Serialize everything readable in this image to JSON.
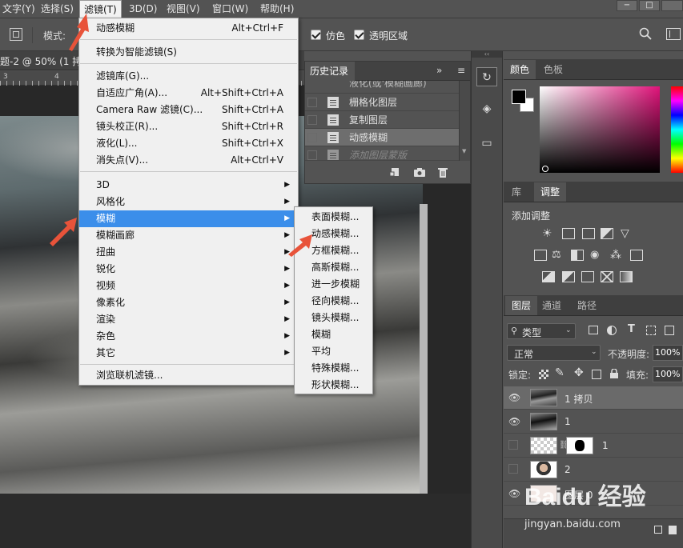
{
  "menubar": {
    "items": [
      "文字(Y)",
      "选择(S)",
      "滤镜(T)",
      "3D(D)",
      "视图(V)",
      "窗口(W)",
      "帮助(H)"
    ],
    "active": "滤镜(T)"
  },
  "window_controls": {
    "minimize": "−",
    "restore": "□"
  },
  "options": {
    "mode_label": "模式:",
    "dither_label": "仿色",
    "transparency_label": "透明区域"
  },
  "doc_tab": {
    "title": "题-2 @ 50% (1 拷"
  },
  "ruler": {
    "marks": [
      "3",
      "4"
    ]
  },
  "filter_menu": {
    "items": [
      {
        "label": "动感模糊",
        "shortcut": "Alt+Ctrl+F"
      },
      {
        "label": "转换为智能滤镜(S)",
        "shortcut": ""
      },
      {
        "label": "滤镜库(G)...",
        "shortcut": ""
      },
      {
        "label": "自适应广角(A)...",
        "shortcut": "Alt+Shift+Ctrl+A"
      },
      {
        "label": "Camera Raw 滤镜(C)...",
        "shortcut": "Shift+Ctrl+A"
      },
      {
        "label": "镜头校正(R)...",
        "shortcut": "Shift+Ctrl+R"
      },
      {
        "label": "液化(L)...",
        "shortcut": "Shift+Ctrl+X"
      },
      {
        "label": "消失点(V)...",
        "shortcut": "Alt+Ctrl+V"
      },
      {
        "label": "3D",
        "shortcut": ""
      },
      {
        "label": "风格化",
        "shortcut": ""
      },
      {
        "label": "模糊",
        "shortcut": ""
      },
      {
        "label": "模糊画廊",
        "shortcut": ""
      },
      {
        "label": "扭曲",
        "shortcut": ""
      },
      {
        "label": "锐化",
        "shortcut": ""
      },
      {
        "label": "视频",
        "shortcut": ""
      },
      {
        "label": "像素化",
        "shortcut": ""
      },
      {
        "label": "渲染",
        "shortcut": ""
      },
      {
        "label": "杂色",
        "shortcut": ""
      },
      {
        "label": "其它",
        "shortcut": ""
      },
      {
        "label": "浏览联机滤镜...",
        "shortcut": ""
      }
    ]
  },
  "blur_submenu": {
    "items": [
      "表面模糊...",
      "动感模糊...",
      "方框模糊...",
      "高斯模糊...",
      "进一步模糊",
      "径向模糊...",
      "镜头模糊...",
      "模糊",
      "平均",
      "特殊模糊...",
      "形状模糊..."
    ]
  },
  "history": {
    "tab": "历史记录",
    "partial_row": "液化(或'模糊画廊)",
    "rows": [
      "栅格化图层",
      "复制图层",
      "动感模糊",
      "添加图层蒙版"
    ]
  },
  "color_panel": {
    "tabs": [
      "颜色",
      "色板"
    ]
  },
  "adjust_panel": {
    "tabs": [
      "库",
      "调整"
    ],
    "title": "添加调整"
  },
  "layers_panel": {
    "tabs": [
      "图层",
      "通道",
      "路径"
    ],
    "kind_filter": "类型",
    "blend_mode": "正常",
    "opacity_label": "不透明度:",
    "opacity_value": "100%",
    "lock_label": "锁定:",
    "fill_label": "填充:",
    "fill_value": "100%",
    "layers": [
      {
        "name": "1 拷贝",
        "visible": true
      },
      {
        "name": "1",
        "visible": true
      },
      {
        "name": "1",
        "visible": false
      },
      {
        "name": "2",
        "visible": false
      },
      {
        "name": "图层 0",
        "visible": true
      }
    ]
  },
  "watermark": {
    "brand": "Baidu 经验",
    "url": "jingyan.baidu.com"
  },
  "colors": {
    "highlight": "#3b8eea",
    "menu_bg": "#f0f0f0",
    "panel_bg": "#535353",
    "annotation_arrow": "#e8533a"
  }
}
